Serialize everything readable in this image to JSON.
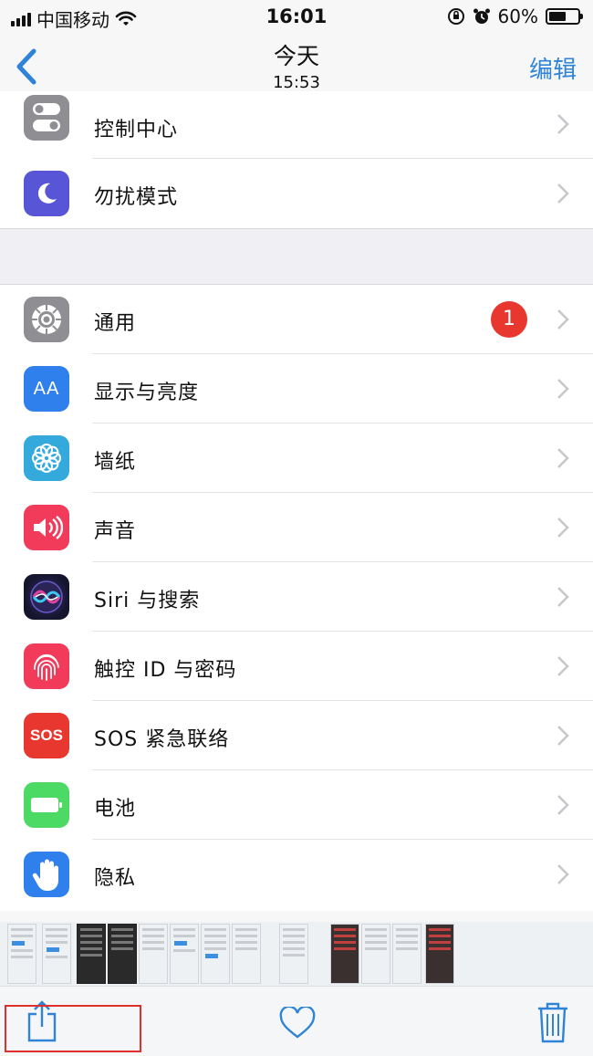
{
  "status_bar": {
    "carrier": "中国移动",
    "time": "16:01",
    "battery_percent": "60%",
    "battery_level": 0.6
  },
  "nav": {
    "title": "今天",
    "subtitle": "15:53",
    "edit_label": "编辑",
    "accent_color": "#2f84d8"
  },
  "settings": {
    "top_group": [
      {
        "label": "控制中心",
        "icon": "control-center-icon",
        "color": "#8e8e93"
      },
      {
        "label": "勿扰模式",
        "icon": "moon-icon",
        "color": "#5856d6"
      }
    ],
    "main_group": [
      {
        "label": "通用",
        "icon": "gear-icon",
        "color": "#8e8e93",
        "badge": "1"
      },
      {
        "label": "显示与亮度",
        "icon": "display-brightness-icon",
        "color": "#2f80ed"
      },
      {
        "label": "墙纸",
        "icon": "wallpaper-flower-icon",
        "color": "#34aadc"
      },
      {
        "label": "声音",
        "icon": "speaker-icon",
        "color": "#f23a5a"
      },
      {
        "label": "Siri 与搜索",
        "icon": "siri-icon",
        "color": "#1c1c3a"
      },
      {
        "label": "触控 ID 与密码",
        "icon": "fingerprint-icon",
        "color": "#f23a5a"
      },
      {
        "label": "SOS 紧急联络",
        "icon": "sos-icon",
        "color": "#e8372f"
      },
      {
        "label": "电池",
        "icon": "battery-icon",
        "color": "#4cd964"
      },
      {
        "label": "隐私",
        "icon": "hand-icon",
        "color": "#2f80ed"
      }
    ]
  },
  "icon_texts": {
    "display": "AA",
    "sos": "SOS"
  },
  "toolbar": {
    "share": "share-icon",
    "favorite": "heart-icon",
    "delete": "trash-icon",
    "highlight_color": "#e0302e"
  }
}
